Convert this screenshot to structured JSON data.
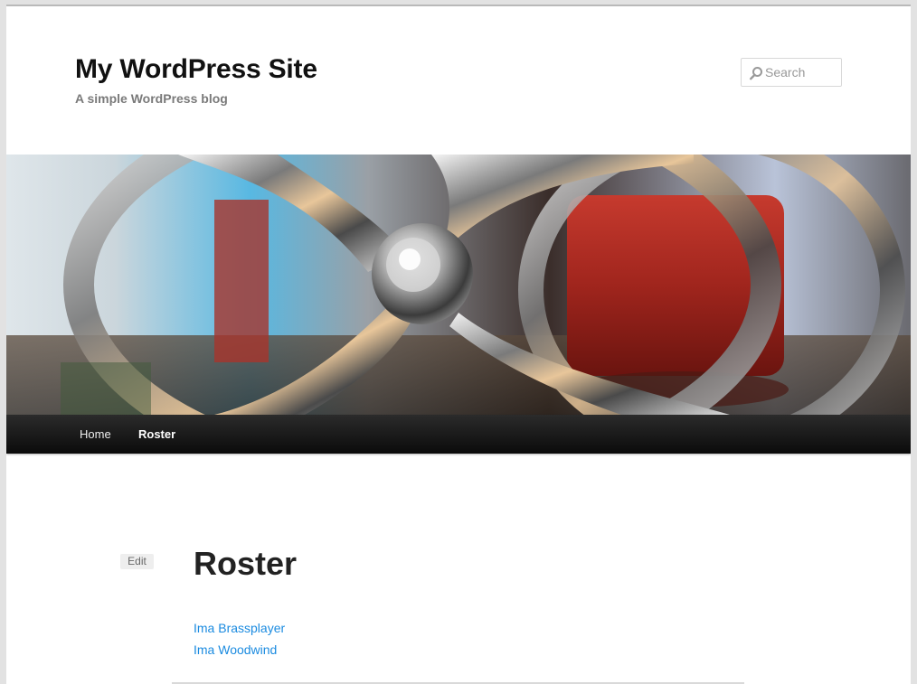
{
  "site": {
    "title": "My WordPress Site",
    "description": "A simple WordPress blog"
  },
  "search": {
    "placeholder": "Search",
    "icon": "search-icon"
  },
  "nav": {
    "items": [
      {
        "label": "Home"
      },
      {
        "label": "Roster",
        "current": true
      }
    ]
  },
  "entry": {
    "edit_label": "Edit",
    "title": "Roster",
    "links": [
      {
        "label": "Ima Brassplayer"
      },
      {
        "label": "Ima Woodwind"
      }
    ]
  },
  "colors": {
    "link": "#1b8be0",
    "nav_background": "#111111",
    "title": "#111111"
  }
}
